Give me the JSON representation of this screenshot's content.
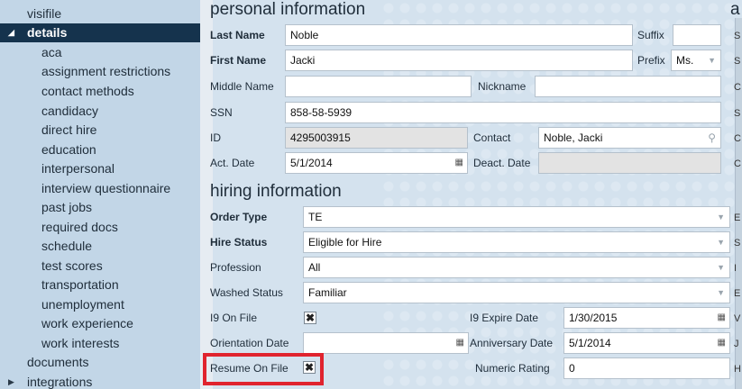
{
  "sidebar": {
    "items": [
      {
        "label": "visifile",
        "level": 0
      },
      {
        "label": "details",
        "level": 0,
        "selected": true,
        "expanded": true
      },
      {
        "label": "aca",
        "level": 1
      },
      {
        "label": "assignment restrictions",
        "level": 1
      },
      {
        "label": "contact methods",
        "level": 1
      },
      {
        "label": "candidacy",
        "level": 1
      },
      {
        "label": "direct hire",
        "level": 1
      },
      {
        "label": "education",
        "level": 1
      },
      {
        "label": "interpersonal",
        "level": 1
      },
      {
        "label": "interview questionnaire",
        "level": 1
      },
      {
        "label": "past jobs",
        "level": 1
      },
      {
        "label": "required docs",
        "level": 1
      },
      {
        "label": "schedule",
        "level": 1
      },
      {
        "label": "test scores",
        "level": 1
      },
      {
        "label": "transportation",
        "level": 1
      },
      {
        "label": "unemployment",
        "level": 1
      },
      {
        "label": "work experience",
        "level": 1
      },
      {
        "label": "work interests",
        "level": 1
      },
      {
        "label": "documents",
        "level": 0
      },
      {
        "label": "integrations",
        "level": 0,
        "collapsed": true
      }
    ]
  },
  "personal": {
    "title": "personal information",
    "last_name_label": "Last Name",
    "last_name": "Noble",
    "suffix_label": "Suffix",
    "suffix": "",
    "first_name_label": "First Name",
    "first_name": "Jacki",
    "prefix_label": "Prefix",
    "prefix": "Ms.",
    "middle_name_label": "Middle Name",
    "middle_name": "",
    "nickname_label": "Nickname",
    "nickname": "",
    "ssn_label": "SSN",
    "ssn": "858-58-5939",
    "id_label": "ID",
    "id": "4295003915",
    "contact_label": "Contact",
    "contact": "Noble, Jacki",
    "act_date_label": "Act. Date",
    "act_date": "5/1/2014",
    "deact_date_label": "Deact. Date",
    "deact_date": ""
  },
  "hiring": {
    "title": "hiring information",
    "order_type_label": "Order Type",
    "order_type": "TE",
    "hire_status_label": "Hire Status",
    "hire_status": "Eligible for Hire",
    "profession_label": "Profession",
    "profession": "All",
    "washed_status_label": "Washed Status",
    "washed_status": "Familiar",
    "i9_on_file_label": "I9 On File",
    "i9_on_file": true,
    "i9_expire_label": "I9 Expire Date",
    "i9_expire": "1/30/2015",
    "orientation_label": "Orientation Date",
    "orientation": "",
    "anniversary_label": "Anniversary Date",
    "anniversary": "5/1/2014",
    "resume_label": "Resume On File",
    "resume_on_file": true,
    "numeric_rating_label": "Numeric Rating",
    "numeric_rating": "0"
  },
  "right_edge": {
    "header_fragment": "a",
    "letters": [
      "S",
      "S",
      "C",
      "S",
      "C",
      "C",
      "E",
      "S",
      "I",
      "E",
      "V",
      "J",
      "H"
    ]
  },
  "icons": {
    "calendar": "calendar-icon",
    "dropdown": "chevron-down-icon",
    "search": "search-icon",
    "expanded": "triangle-down-icon",
    "collapsed": "triangle-right-icon"
  },
  "colors": {
    "sidebar_bg": "#c2d6e7",
    "selected_bg": "#15334d",
    "main_bg": "#d4e2ee",
    "highlight": "#e0232e"
  }
}
